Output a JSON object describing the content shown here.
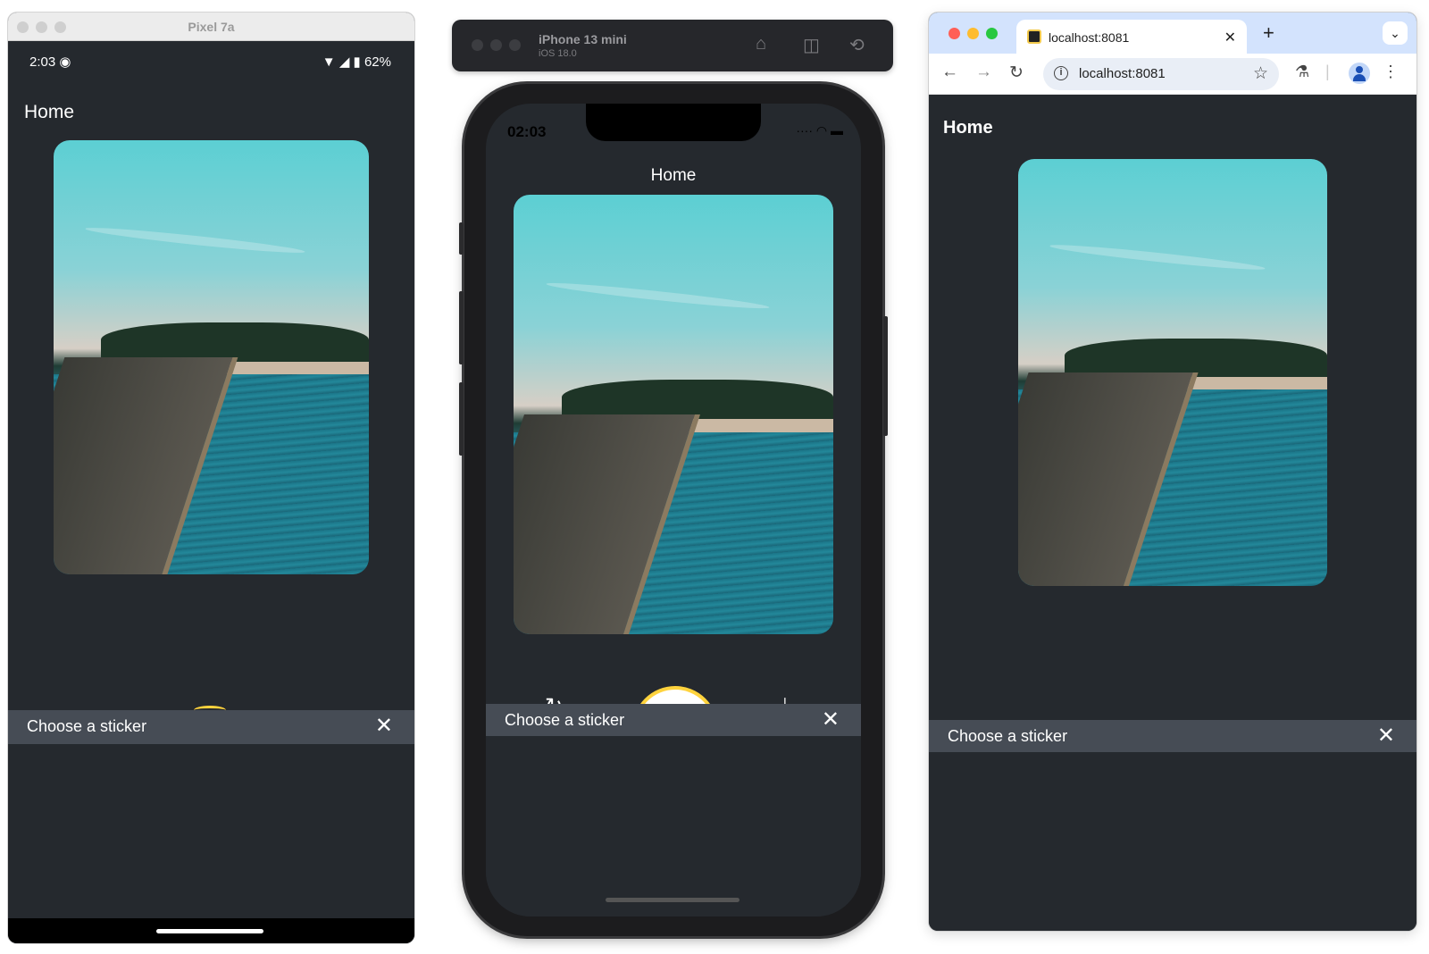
{
  "android": {
    "window_title": "Pixel 7a",
    "status": {
      "time": "2:03",
      "battery": "62%"
    },
    "header_title": "Home",
    "sheet": {
      "title": "Choose a sticker",
      "close_glyph": "✕"
    }
  },
  "ios": {
    "toolbar": {
      "device_name": "iPhone 13 mini",
      "os_version": "iOS 18.0"
    },
    "status": {
      "time": "02:03"
    },
    "header_title": "Home",
    "controls": {
      "refresh_glyph": "↻",
      "download_glyph": "⤓"
    },
    "sheet": {
      "title": "Choose a sticker",
      "close_glyph": "✕"
    }
  },
  "chrome": {
    "tab": {
      "title": "localhost:8081",
      "close_glyph": "✕"
    },
    "new_tab_glyph": "+",
    "address": "localhost:8081",
    "header_title": "Home",
    "sheet": {
      "title": "Choose a sticker",
      "close_glyph": "✕"
    }
  },
  "colors": {
    "app_background": "#25292e",
    "sheet_bar": "#464c55",
    "accent_yellow": "#ffd33d"
  },
  "icons": [
    "wifi-icon",
    "signal-icon",
    "battery-icon",
    "home-icon",
    "screenshot-icon",
    "rotate-icon",
    "refresh-icon",
    "download-icon",
    "close-icon",
    "back-arrow-icon",
    "forward-arrow-icon",
    "reload-icon",
    "info-icon",
    "star-icon",
    "labs-flask-icon",
    "profile-icon",
    "kebab-menu-icon",
    "chevron-down-icon"
  ]
}
